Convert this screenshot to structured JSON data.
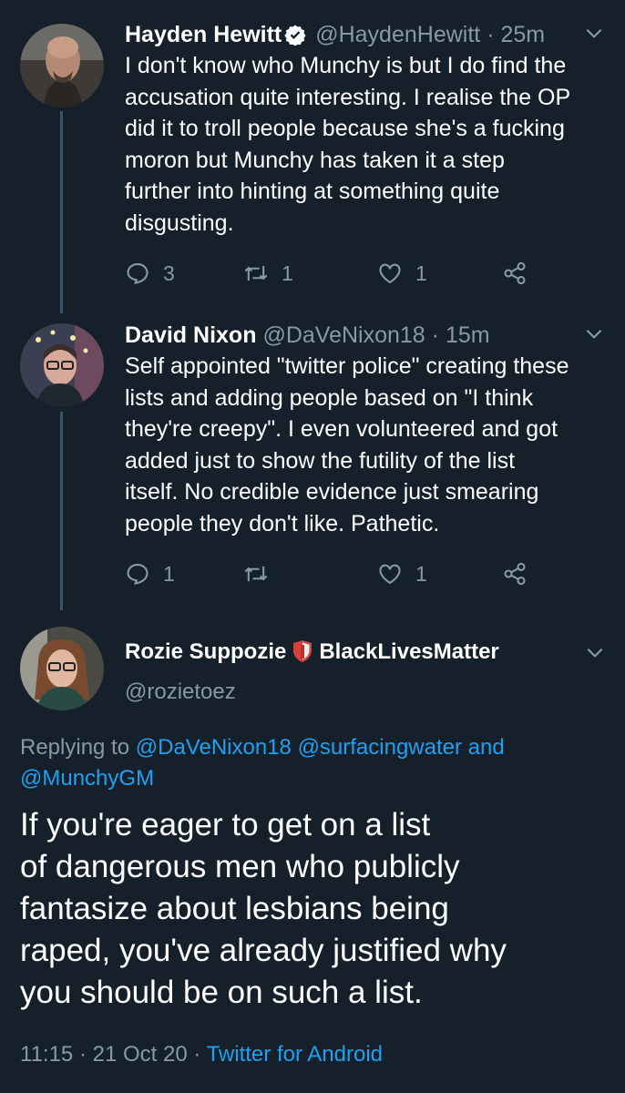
{
  "tweets": [
    {
      "name": "Hayden Hewitt",
      "handle": "@HaydenHewitt",
      "sep": "·",
      "time": "25m",
      "lines": [
        "I don't know who Munchy is but I do find the",
        "accusation quite interesting. I realise the OP",
        "did it to troll people because she's a fucking",
        "moron but Munchy has taken it a step",
        "further into hinting at something quite",
        "disgusting."
      ],
      "replies": "3",
      "retweets": "1",
      "likes": "1"
    },
    {
      "name": "David Nixon",
      "handle": "@DaVeNixon18",
      "sep": "·",
      "time": "15m",
      "lines": [
        "Self appointed \"twitter police\" creating these",
        "lists and adding people based on \"I think",
        "they're creepy\". I even volunteered and got",
        "added just to show the futility of the list",
        "itself. No credible evidence just smearing",
        "people they don't like. Pathetic."
      ],
      "replies": "1",
      "retweets": "",
      "likes": "1"
    }
  ],
  "main": {
    "name": "Rozie Suppozie",
    "name_suffix": "BlackLivesMatter",
    "handle": "@rozietoez",
    "replying_prefix": "Replying to",
    "replying_user1": "@DaVeNixon18",
    "replying_user2": "@surfacingwater",
    "replying_and": "and",
    "replying_user3": "@MunchyGM",
    "lines": [
      "If you're eager to get on a list",
      "of dangerous men who publicly",
      "fantasize about lesbians being",
      "raped, you've already justified why",
      "you should be on such a list."
    ],
    "time": "11:15",
    "sep": "·",
    "date": "21 Oct 20",
    "source": "Twitter for Android"
  },
  "colors": {
    "background": "#15202b",
    "muted": "#8899a6",
    "link": "#1da1f2",
    "thread_line": "#3d5466"
  },
  "icons": [
    "verified-badge-icon",
    "chevron-down-icon",
    "reply-icon",
    "retweet-icon",
    "like-icon",
    "share-icon",
    "shield-emoji-icon"
  ]
}
